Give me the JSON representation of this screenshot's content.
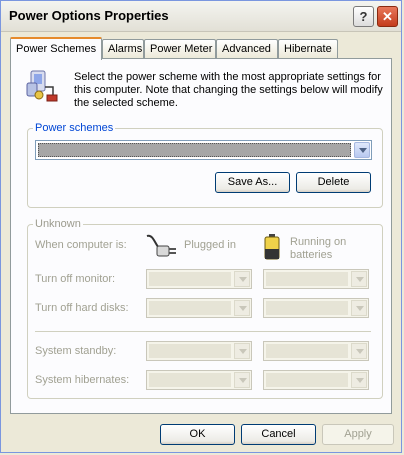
{
  "window": {
    "title": "Power Options Properties",
    "help_glyph": "?",
    "close_glyph": "✕"
  },
  "tabs": [
    {
      "label": "Power Schemes",
      "active": true
    },
    {
      "label": "Alarms",
      "underline_char": "A"
    },
    {
      "label": "Power Meter"
    },
    {
      "label": "Advanced"
    },
    {
      "label": "Hibernate"
    }
  ],
  "description": "Select the power scheme with the most appropriate settings for this computer. Note that changing the settings below will modify the selected scheme.",
  "power_schemes": {
    "label": "Power schemes",
    "selected_value": "",
    "save_as_label": "Save As...",
    "delete_label": "Delete"
  },
  "settings": {
    "group_label": "Unknown",
    "when_computer_is": "When computer is:",
    "plugged_in": "Plugged in",
    "running_on_batteries_line1": "Running on",
    "running_on_batteries_line2": "batteries",
    "rows": [
      {
        "label": "Turn off monitor:"
      },
      {
        "label": "Turn off hard disks:"
      },
      {
        "label": "System standby:"
      },
      {
        "label": "System hibernates:"
      }
    ]
  },
  "footer": {
    "ok_label": "OK",
    "cancel_label": "Cancel",
    "apply_label": "Apply"
  },
  "colors": {
    "accent_tab": "#e68b2c",
    "group_label_active": "#0046d5",
    "disabled_text": "#a1a192"
  }
}
